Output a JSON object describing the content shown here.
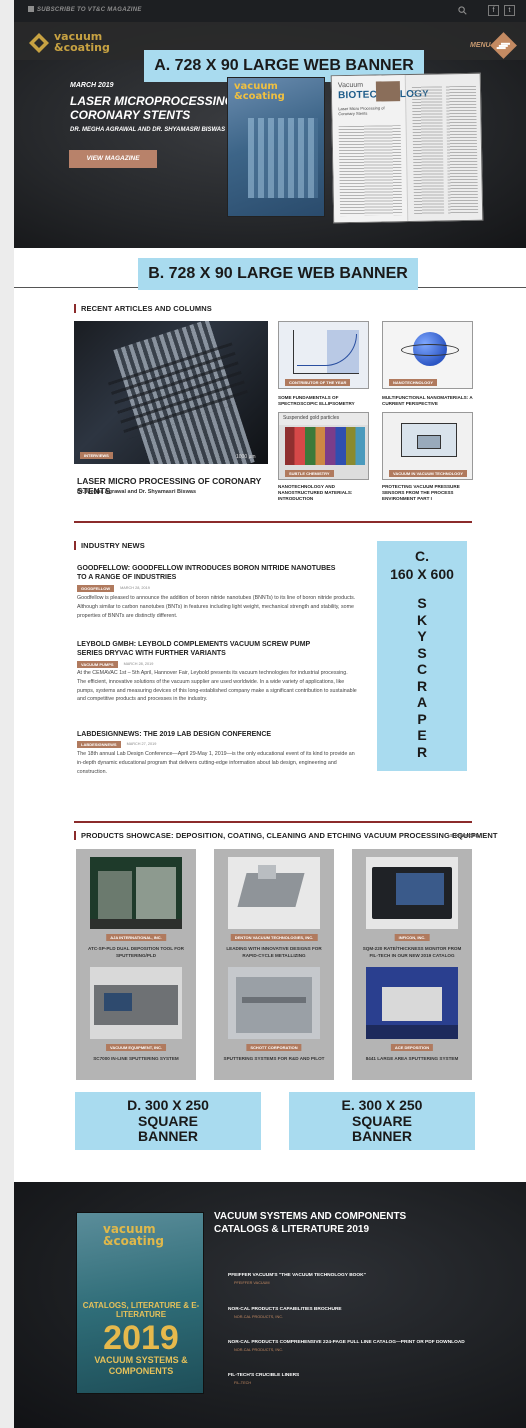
{
  "topbar": {
    "subscribe": "SUBSCRIBE TO VT&C MAGAZINE",
    "social": [
      "f",
      "t"
    ]
  },
  "brand": {
    "line1": "vacuum",
    "line2": "&coating"
  },
  "banners": {
    "a": "A. 728 X 90 LARGE WEB BANNER",
    "b": "B. 728 X 90 LARGE WEB BANNER",
    "c": {
      "line1": "C.",
      "line2": "160 X 600",
      "letters": [
        "S",
        "K",
        "Y",
        "S",
        "C",
        "R",
        "A",
        "P",
        "E",
        "R"
      ]
    },
    "d": [
      "D. 300 X 250",
      "SQUARE",
      "BANNER"
    ],
    "e": [
      "E. 300 X 250",
      "SQUARE",
      "BANNER"
    ]
  },
  "menu": {
    "label": "MENU"
  },
  "hero": {
    "date": "MARCH 2019",
    "title": "LASER MICROPROCESSING OF CORONARY STENTS",
    "authors": "DR. MEGHA AGRAWAL AND DR. SHYAMASRI BISWAS",
    "button": "VIEW MAGAZINE",
    "cover_title": "vacuum &coating",
    "spread_head1": "Vacuum",
    "spread_head2": "BIOTECHNOLOGY",
    "spread_sub": "Laser Micro Processing of Coronary Stents",
    "slides": 4,
    "active_slide": 1
  },
  "recent": {
    "heading": "RECENT ARTICLES AND COLUMNS",
    "featured": {
      "tag": "INTERVIEWS",
      "scale": "1000 µm",
      "title": "LASER MICRO PROCESSING OF CORONARY STENTS",
      "authors": "Dr. Megha Agrawal and Dr. Shyamasri Biswas"
    },
    "thumbs": [
      {
        "tag": "CONTRIBUTOR OF THE YEAR",
        "title": "SOME FUNDAMENTALS OF SPECTROSCOPIC ELLIPSOMETRY"
      },
      {
        "tag": "NANOTECHNOLOGY",
        "title": "MULTIFUNCTIONAL NANOMATERIALS: A CURRENT PERSPECTIVE"
      },
      {
        "tag": "SUBTLE CHEMISTRY",
        "title": "NANOTECHNOLOGY AND NANOSTRUCTURED MATERIALS: INTRODUCTION",
        "caption": "Suspended gold particles"
      },
      {
        "tag": "VACUUM IN VACUUM TECHNOLOGY",
        "title": "PROTECTING VACUUM PRESSURE SENSORS FROM THE PROCESS ENVIRONMENT PART I"
      }
    ]
  },
  "news": {
    "heading": "INDUSTRY NEWS",
    "items": [
      {
        "title": "GOODFELLOW: GOODFELLOW INTRODUCES BORON NITRIDE NANOTUBES TO A RANGE OF INDUSTRIES",
        "tag": "GOODFELLOW",
        "date": "MARCH 28, 2019",
        "body": "Goodfellow is pleased to announce the addition of boron nitride nanotubes (BNNTs) to its line of boron nitride products. Although similar to carbon nanotubes (BNTs) in features including light weight, mechanical strength and stability, some properties of BNNTs are distinctly different."
      },
      {
        "title": "LEYBOLD GMBH: LEYBOLD COMPLEMENTS VACUUM SCREW PUMP SERIES DRYVAC WITH FURTHER VARIANTS",
        "tag": "VACUUM PUMPS",
        "date": "MARCH 28, 2019",
        "body": "At the CEMAVAC 1st – 5th April, Hannover Fair, Leybold presents its vacuum technologies for industrial processing. The efficient, innovative solutions of the vacuum supplier are used worldwide. In a wide variety of applications, like pumps, systems and measuring devices of this long-established company make a significant contribution to sustainable and competitive products and processes in the industry."
      },
      {
        "title": "LABDESIGNNEWS: THE 2019 LAB DESIGN CONFERENCE",
        "tag": "LABDESIGNNEWS",
        "date": "MARCH 27, 2019",
        "body": "The 18th annual Lab Design Conference—April 29-May 1, 2019—is the only educational event of its kind to provide an in-depth dynamic educational program that delivers cutting-edge information about lab design, engineering and construction."
      }
    ]
  },
  "products": {
    "heading": "PRODUCTS SHOWCASE: DEPOSITION, COATING, CLEANING AND ETCHING VACUUM PROCESSING EQUIPMENT",
    "show_more": "SHOW MORE",
    "items": [
      {
        "tag": "AJA INTERNATIONAL, INC.",
        "title": "ATC-SP-PLD DUAL DEPOSITION TOOL FOR SPUTTERING/PLD"
      },
      {
        "tag": "DENTON VACUUM TECHNOLOGIES, INC.",
        "title": "LEADING WITH INNOVATIVE DESIGNS FOR RAPID-CYCLE METALLIZING"
      },
      {
        "tag": "INFICON, INC.",
        "title": "SQM-220 RATE/THICKNESS MONITOR FROM FIL-TECH IN OUR NEW 2019 CATALOG"
      },
      {
        "tag": "VACUUM EQUIPMENT, INC.",
        "title": "SC7000 IN-LINE SPUTTERING SYSTEM"
      },
      {
        "tag": "SCHOTT CORPORATION",
        "title": "SPUTTERING SYSTEMS FOR R&D AND PILOT"
      },
      {
        "tag": "ACE DEPOSITION",
        "title": "8441 LARGE AREA SPUTTERING SYSTEM"
      }
    ]
  },
  "catalogs": {
    "title": "VACUUM SYSTEMS AND COMPONENTS CATALOGS & LITERATURE 2019",
    "cover": {
      "brand": "vacuum &coating",
      "mid": "CATALOGS, LITERATURE & E-LITERATURE",
      "year": "2019",
      "bottom": "VACUUM SYSTEMS & COMPONENTS"
    },
    "items": [
      {
        "title": "PFEIFFER VACUUM'S \"THE VACUUM TECHNOLOGY BOOK\"",
        "source": "PFEIFFER VACUUM"
      },
      {
        "title": "NOR-CAL PRODUCTS CAPABILITIES BROCHURE",
        "source": "NOR-CAL PRODUCTS, INC."
      },
      {
        "title": "NOR-CAL PRODUCTS COMPREHENSIVE 224-PAGE FULL LINE CATALOG—PRINT OR PDF DOWNLOAD",
        "source": "NOR-CAL PRODUCTS, INC."
      },
      {
        "title": "FIL-TECH'S CRUCIBLE LINERS",
        "source": "FIL-TECH"
      }
    ]
  },
  "colors": {
    "accent": "#c48a62",
    "rule": "#8b2b2b",
    "banner": "#a9dbef",
    "dark": "#1d1f22"
  }
}
